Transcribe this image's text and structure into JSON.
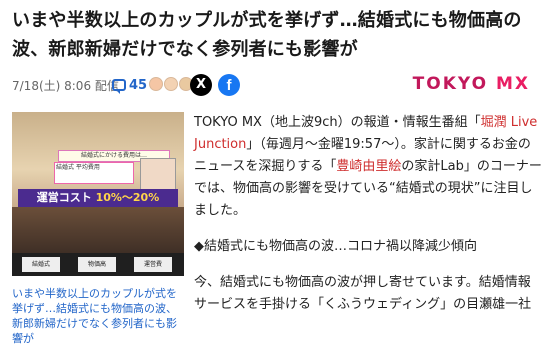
{
  "headline": "いまや半数以上のカップルが式を挙げず…結婚式にも物価高の波、新郎新婦だけでなく参列者にも影響が",
  "meta": {
    "date": "7/18(土) 8:06 配信",
    "comment_count": "45",
    "share_x_label": "X",
    "share_fb_label": "f",
    "publisher_logo_tokyo": "TOKYO",
    "publisher_logo_mx": "MX"
  },
  "thumbnail": {
    "banner_text": "結婚式にかける費用は…",
    "box_text": "結婚式 平均費用",
    "cost_label": "運営コスト",
    "cost_range": "10%〜20%",
    "tag_1": "結婚式",
    "tag_2": "物価高",
    "tag_3": "運営費"
  },
  "caption": "いまや半数以上のカップルが式を挙げず…結婚式にも物価高の波、新郎新婦だけでなく参列者にも影響が",
  "article": {
    "p1_a": "TOKYO MX（地上波9ch）の報道・情報生番組「",
    "p1_link": "堀潤 Live Junction",
    "p1_b": "」（毎週月〜金曜19:57〜）。家計に関するお金のニュースを深掘りする「",
    "p1_link2": "豊崎由里絵",
    "p1_c": "の家計Lab」のコーナーでは、物価高の影響を受けている“結婚式の現状”に注目しました。",
    "subheading": "◆結婚式にも物価高の波…コロナ禍以降減少傾向",
    "p2": "今、結婚式にも物価高の波が押し寄せています。結婚情報サービスを手掛ける「くふうウェディング」の目瀬雄一社"
  }
}
